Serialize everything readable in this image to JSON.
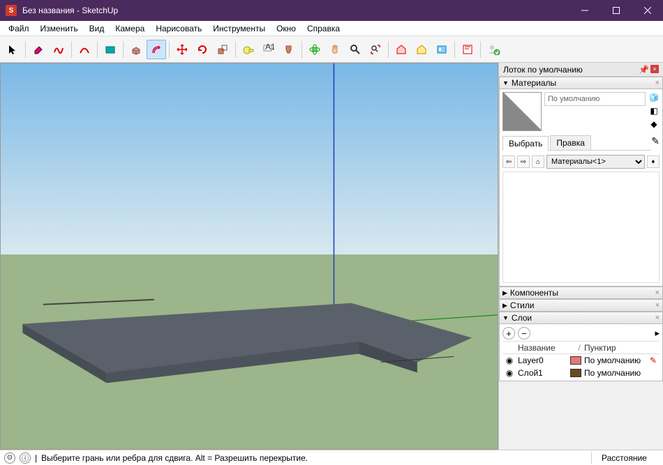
{
  "title": "Без названия - SketchUp",
  "menu": [
    "Файл",
    "Изменить",
    "Вид",
    "Камера",
    "Нарисовать",
    "Инструменты",
    "Окно",
    "Справка"
  ],
  "toolbar": {
    "tools": [
      {
        "name": "select-tool",
        "glyph": "cursor"
      },
      {
        "sep": true
      },
      {
        "name": "eraser-tool",
        "glyph": "eraser",
        "color": "#d08"
      },
      {
        "name": "line-tool",
        "glyph": "freehand",
        "color": "#d00"
      },
      {
        "sep": true
      },
      {
        "name": "arc-tool",
        "glyph": "arc",
        "color": "#d00"
      },
      {
        "sep": true
      },
      {
        "name": "rectangle-tool",
        "glyph": "rect",
        "color": "#066"
      },
      {
        "sep": true
      },
      {
        "name": "pushpull-tool",
        "glyph": "pushpull",
        "color": "#944"
      },
      {
        "name": "offset-tool",
        "glyph": "offset",
        "color": "#d04",
        "active": true
      },
      {
        "sep": true
      },
      {
        "name": "move-tool",
        "glyph": "move",
        "color": "#d00"
      },
      {
        "name": "rotate-tool",
        "glyph": "rotate",
        "color": "#d00"
      },
      {
        "name": "scale-tool",
        "glyph": "scale",
        "color": "#a60"
      },
      {
        "sep": true
      },
      {
        "name": "tape-tool",
        "glyph": "tape",
        "color": "#aa0"
      },
      {
        "name": "text-tool",
        "glyph": "text"
      },
      {
        "name": "paint-tool",
        "glyph": "paint",
        "color": "#a60"
      },
      {
        "sep": true
      },
      {
        "name": "orbit-tool",
        "glyph": "orbit",
        "color": "#0a0"
      },
      {
        "name": "pan-tool",
        "glyph": "pan",
        "color": "#c85"
      },
      {
        "name": "zoom-tool",
        "glyph": "zoom"
      },
      {
        "name": "zoom-extents-tool",
        "glyph": "zoomext"
      },
      {
        "sep": true
      },
      {
        "name": "warehouse-tool",
        "glyph": "warehouse",
        "color": "#d00"
      },
      {
        "name": "warehouse2-tool",
        "glyph": "warehouse2",
        "color": "#c80"
      },
      {
        "name": "extension-tool",
        "glyph": "ext",
        "color": "#08a"
      },
      {
        "sep": true
      },
      {
        "name": "layout-tool",
        "glyph": "layout",
        "color": "#d00"
      },
      {
        "sep": true
      },
      {
        "name": "user-tool",
        "glyph": "user"
      }
    ]
  },
  "tray": {
    "title": "Лоток по умолчанию",
    "materials": {
      "title": "Материалы",
      "default_name": "По умолчанию",
      "tab_select": "Выбрать",
      "tab_edit": "Правка",
      "collection": "Материалы<1>"
    },
    "panels": {
      "components": "Компоненты",
      "styles": "Стили",
      "layers": "Слои"
    },
    "layers": {
      "head_name": "Название",
      "head_dash": "Пунктир",
      "rows": [
        {
          "name": "Layer0",
          "swatch": "#e87878",
          "dash": "По умолчанию",
          "indicator": true
        },
        {
          "name": "Слой1",
          "swatch": "#6b4a1e",
          "dash": "По умолчанию",
          "indicator": false
        }
      ]
    }
  },
  "statusbar": {
    "hint": "Выберите грань или ребра для сдвига. Alt = Разрешить перекрытие.",
    "distance_label": "Расстояние"
  }
}
